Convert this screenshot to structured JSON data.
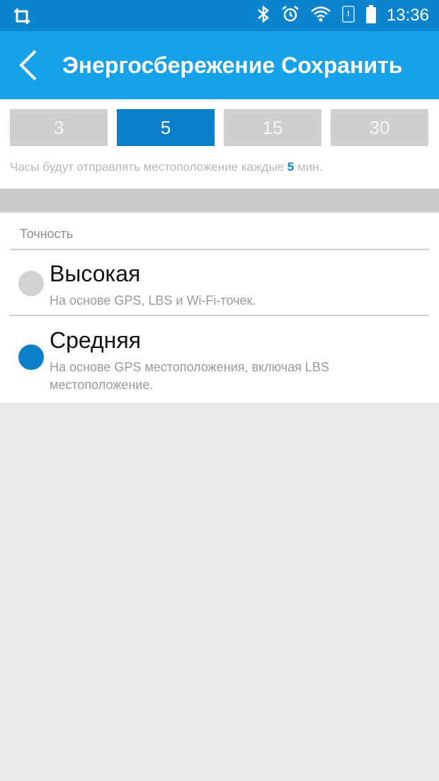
{
  "status_bar": {
    "time": "13:36",
    "icons": [
      "screenshot-icon",
      "bluetooth-icon",
      "alarm-icon",
      "wifi-icon",
      "sim-icon",
      "battery-icon"
    ]
  },
  "app_bar": {
    "title": "Энергосбережение Сохранить"
  },
  "intervals": {
    "options": [
      "3",
      "5",
      "15",
      "30"
    ],
    "selected": "5",
    "hint_prefix": "Часы будут отправлять местоположение каждые",
    "hint_value": "5",
    "hint_suffix": "мин."
  },
  "accuracy": {
    "label": "Точность",
    "options": [
      {
        "name": "Высокая",
        "description": "На основе GPS, LBS и Wi-Fi-точек.",
        "selected": false
      },
      {
        "name": "Средняя",
        "description": "На основе GPS местоположения, включая LBS местоположение.",
        "selected": true
      }
    ]
  },
  "colors": {
    "status_bar": "#0a84cf",
    "app_bar": "#16a1ea",
    "accent": "#0a7fcb",
    "inactive": "#cfcfcf"
  }
}
